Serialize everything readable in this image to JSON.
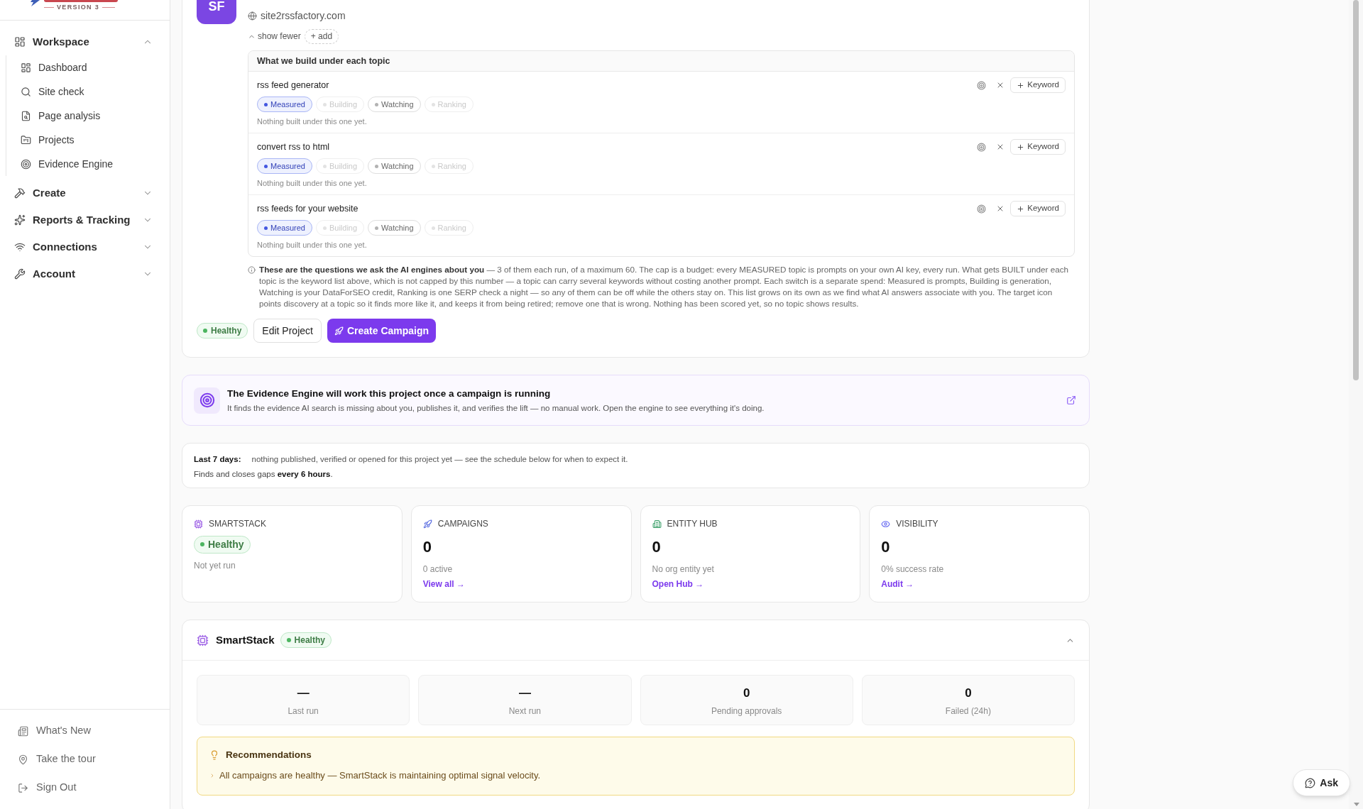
{
  "sidebar": {
    "logo": {
      "tagline": "VERSION 3"
    },
    "nav": [
      {
        "label": "Workspace",
        "expanded": true,
        "children": [
          {
            "label": "Dashboard"
          },
          {
            "label": "Site check"
          },
          {
            "label": "Page analysis"
          },
          {
            "label": "Projects"
          },
          {
            "label": "Evidence Engine"
          }
        ]
      },
      {
        "label": "Create",
        "expanded": false
      },
      {
        "label": "Reports & Tracking",
        "expanded": false
      },
      {
        "label": "Connections",
        "expanded": false
      },
      {
        "label": "Account",
        "expanded": false
      }
    ],
    "footer": [
      {
        "label": "What's New"
      },
      {
        "label": "Take the tour"
      },
      {
        "label": "Sign Out"
      }
    ]
  },
  "project": {
    "initials": "SF",
    "domain": "site2rssfactory.com",
    "toggle": "show fewer",
    "add": "+ add",
    "topics": {
      "heading": "What we build under each topic",
      "rows": [
        {
          "name": "rss feed generator",
          "switches": [
            {
              "label": "Measured",
              "on": true,
              "disabled": false
            },
            {
              "label": "Building",
              "on": false,
              "disabled": true
            },
            {
              "label": "Watching",
              "on": false,
              "disabled": false
            },
            {
              "label": "Ranking",
              "on": false,
              "disabled": true
            }
          ],
          "note": "Nothing built under this one yet.",
          "keyword": "Keyword"
        },
        {
          "name": "convert rss to html",
          "switches": [
            {
              "label": "Measured",
              "on": true,
              "disabled": false
            },
            {
              "label": "Building",
              "on": false,
              "disabled": true
            },
            {
              "label": "Watching",
              "on": false,
              "disabled": false
            },
            {
              "label": "Ranking",
              "on": false,
              "disabled": true
            }
          ],
          "note": "Nothing built under this one yet.",
          "keyword": "Keyword"
        },
        {
          "name": "rss feeds for your website",
          "switches": [
            {
              "label": "Measured",
              "on": true,
              "disabled": false
            },
            {
              "label": "Building",
              "on": false,
              "disabled": true
            },
            {
              "label": "Watching",
              "on": false,
              "disabled": false
            },
            {
              "label": "Ranking",
              "on": false,
              "disabled": true
            }
          ],
          "note": "Nothing built under this one yet.",
          "keyword": "Keyword"
        }
      ]
    },
    "footnote": "**These are the questions we ask the AI engines about you** — 3 of them each run, of a maximum 60. The cap is a budget: every MEASURED topic is prompts on your own AI key, every run. What gets BUILT under each topic is the keyword list above, which is not capped by this number — a topic can carry several keywords without costing another prompt. Each switch is a separate spend: Measured is prompts, Building is generation, Watching is your DataForSEO credit, Ranking is one SERP check a night — so any of them can be off while the others stay on. This list grows on its own as we find what AI answers associate with you. The target icon points discovery at a topic so it finds more like it, and keeps it from being retired; remove one that is wrong. Nothing has been scored yet, so no topic shows results.",
    "badge": "Healthy",
    "actions": [
      {
        "label": "Edit Project",
        "kind": "secondary"
      },
      {
        "label": "Create Campaign",
        "kind": "primary"
      }
    ]
  },
  "evidence_engine": {
    "title": "The Evidence Engine will work this project once a campaign is running",
    "text": "It finds the evidence AI search is missing about you, publishes it, and verifies the lift — no manual work. Open the engine to see everything it's doing."
  },
  "activity": {
    "label": "Last 7 days:",
    "text": "nothing published, verified or opened for this project yet — see the schedule below for when to expect it.",
    "schedule": "Finds and closes gaps **every 6 hours**."
  },
  "stats": [
    {
      "title": "SMARTSTACK",
      "kind": "badge",
      "badge": "Healthy",
      "note": "Not yet run"
    },
    {
      "title": "CAMPAIGNS",
      "kind": "count",
      "value": "0",
      "note": "0 active",
      "link": "View all →"
    },
    {
      "title": "ENTITY HUB",
      "kind": "count",
      "value": "0",
      "note": "No org entity yet",
      "link": "Open Hub →"
    },
    {
      "title": "VISIBILITY",
      "kind": "count",
      "value": "0",
      "note": "0% success rate",
      "link": "Audit →"
    }
  ],
  "smartstack": {
    "title": "SmartStack",
    "badge": "Healthy",
    "expanded": true,
    "metrics": [
      {
        "value": "—",
        "label": "Last run"
      },
      {
        "value": "—",
        "label": "Next run"
      },
      {
        "value": "0",
        "label": "Pending approvals"
      },
      {
        "value": "0",
        "label": "Failed (24h)"
      }
    ],
    "recommendations": {
      "title": "Recommendations",
      "items": [
        "All campaigns are healthy — SmartStack is maintaining optimal signal velocity."
      ]
    }
  },
  "assistant": {
    "label": "Ask"
  }
}
